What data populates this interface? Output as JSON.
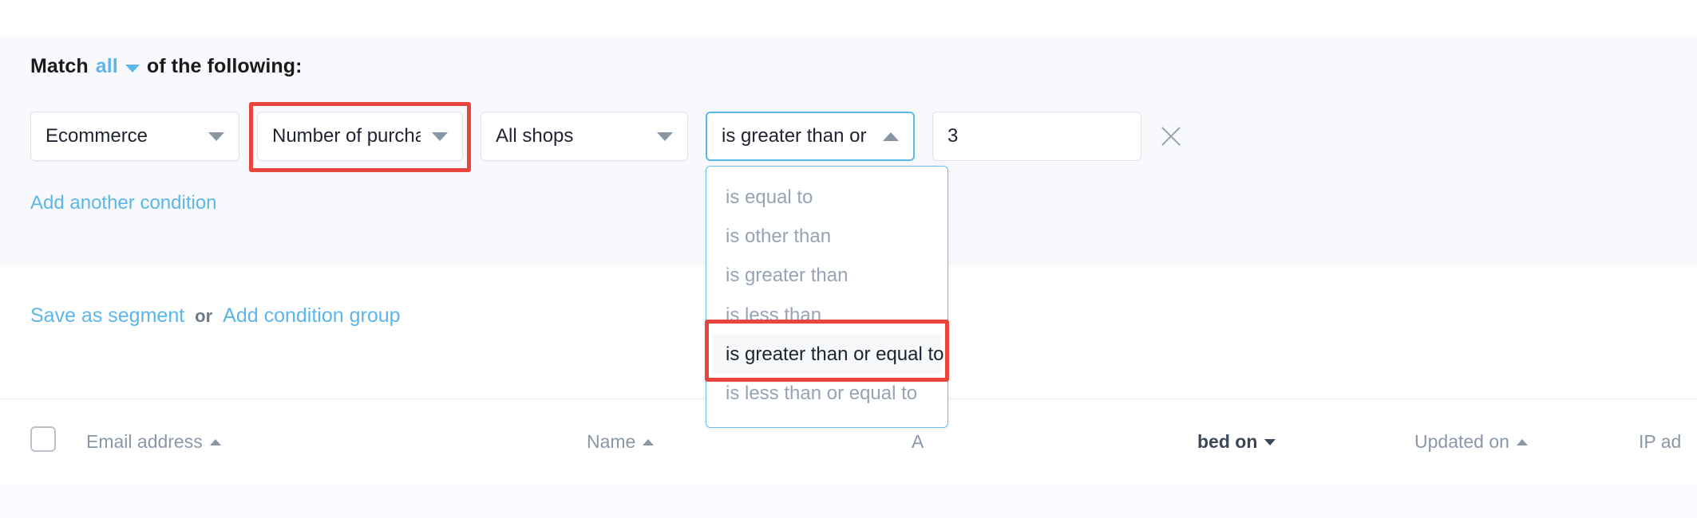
{
  "filter": {
    "match_prefix": "Match",
    "match_value": "all",
    "match_suffix": "of the following:",
    "condition": {
      "source": "Ecommerce",
      "field": "Number of purcha...",
      "shop": "All shops",
      "operator": "is greater than or ...",
      "value": "3",
      "value_placeholder": "",
      "remove_label": "×"
    },
    "operator_options": [
      "is equal to",
      "is other than",
      "is greater than",
      "is less than",
      "is greater than or equal to",
      "is less than or equal to"
    ],
    "operator_selected": "is greater than or equal to",
    "add_another": "Add another condition",
    "save_as_segment": "Save as segment",
    "or_word": "or",
    "add_condition_group": "Add condition group"
  },
  "table": {
    "columns": [
      {
        "label": "Email address",
        "sort": "asc",
        "emphasis": false
      },
      {
        "label": "Name",
        "sort": "asc",
        "emphasis": false
      },
      {
        "label": "A",
        "sort": "none",
        "emphasis": false
      },
      {
        "label": "bed on",
        "sort": "desc",
        "emphasis": true
      },
      {
        "label": "Updated on",
        "sort": "asc",
        "emphasis": false
      },
      {
        "label": "IP ad",
        "sort": "none",
        "emphasis": false
      }
    ]
  },
  "colors": {
    "accent_blue": "#5bb6ea",
    "highlight_red": "#e8453c",
    "panel_bg": "#f8f9fc",
    "muted_text": "#97a3b4"
  }
}
